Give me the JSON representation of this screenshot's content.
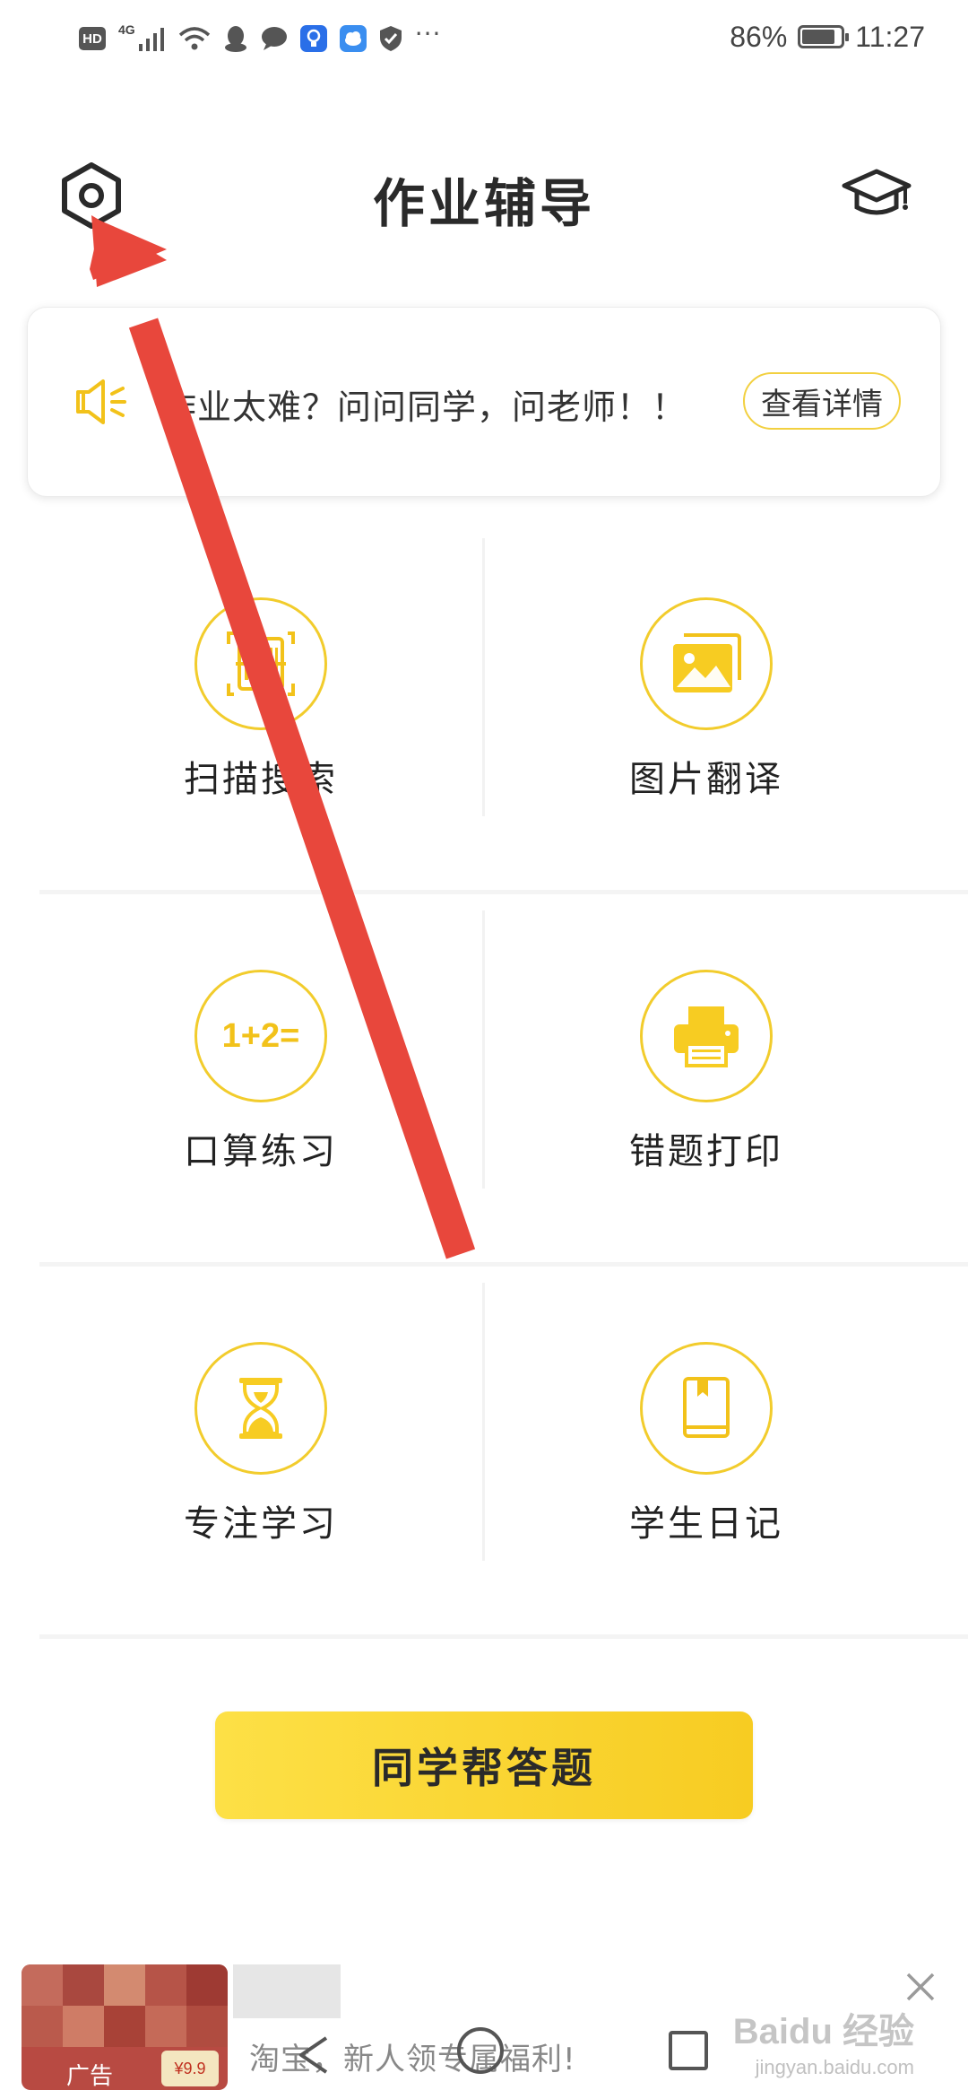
{
  "status_bar": {
    "hd_label": "HD",
    "network_label": "4G",
    "more": "···",
    "battery_percent": "86%",
    "battery_level": 0.86,
    "time": "11:27"
  },
  "header": {
    "title": "作业辅导"
  },
  "notice": {
    "text": "作业太难？问问同学，问老师！！",
    "button": "查看详情"
  },
  "features": [
    {
      "label": "扫描搜索",
      "icon": "barcode-scan-icon"
    },
    {
      "label": "图片翻译",
      "icon": "image-gallery-icon"
    },
    {
      "label": "口算练习",
      "icon_text": "1+2="
    },
    {
      "label": "错题打印",
      "icon": "printer-icon"
    },
    {
      "label": "专注学习",
      "icon": "hourglass-icon"
    },
    {
      "label": "学生日记",
      "icon": "diary-book-icon"
    }
  ],
  "cta": {
    "label": "同学帮答题"
  },
  "ad": {
    "badge": "广告",
    "price_tag": "¥9.9",
    "text": "淘宝，新人领专属福利!"
  },
  "watermark": {
    "main": "Baidu 经验",
    "sub": "jingyan.baidu.com"
  },
  "colors": {
    "accent_yellow": "#f7cc22",
    "annotation_red": "#e8473c"
  }
}
